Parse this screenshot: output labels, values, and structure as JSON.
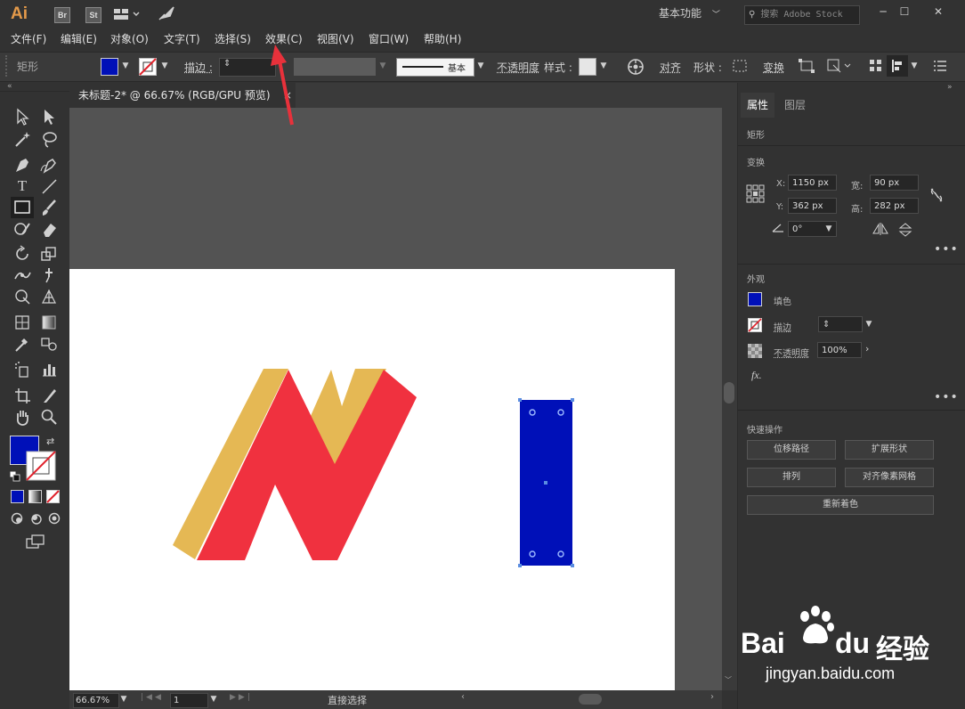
{
  "app": {
    "logo": "Ai",
    "bridge_label": "Br",
    "stock_label": "St"
  },
  "titlebar": {
    "workspace": "基本功能",
    "search_placeholder": "搜索 Adobe Stock",
    "min": "─",
    "max": "☐",
    "close": "✕"
  },
  "menu": [
    "文件(F)",
    "编辑(E)",
    "对象(O)",
    "文字(T)",
    "选择(S)",
    "效果(C)",
    "视图(V)",
    "窗口(W)",
    "帮助(H)"
  ],
  "controlbar": {
    "tool_name": "矩形",
    "fill_color": "#0010b8",
    "stroke_label": "描边 :",
    "stroke_style": "基本",
    "opacity_label": "不透明度",
    "style_label": "样式 :",
    "align_label": "对齐",
    "shape_label": "形状 :",
    "transform_label": "变换"
  },
  "document": {
    "tab_title": "未标题-2* @ 66.67% (RGB/GPU 预览)",
    "close": "×"
  },
  "statusbar": {
    "zoom": "66.67%",
    "artboard": "1",
    "tool_status": "直接选择"
  },
  "panel": {
    "tabs": [
      "属性",
      "图层"
    ],
    "object_type": "矩形",
    "transform": {
      "title": "变换",
      "x_label": "X:",
      "x_value": "1150 px",
      "y_label": "Y:",
      "y_value": "362 px",
      "w_label": "宽:",
      "w_value": "90 px",
      "h_label": "高:",
      "h_value": "282 px",
      "angle_value": "0°"
    },
    "appearance": {
      "title": "外观",
      "fill_label": "填色",
      "fill_color": "#0010b8",
      "stroke_label": "描边",
      "opacity_label": "不透明度",
      "opacity_value": "100%",
      "fx_label": "fx."
    },
    "quick_actions": {
      "title": "快速操作",
      "buttons": [
        "位移路径",
        "扩展形状",
        "排列",
        "对齐像素网格",
        "重新着色"
      ]
    }
  },
  "artwork": {
    "shadow_color": "#e5b854",
    "front_color": "#f0313f",
    "rect_color": "#0010b8"
  },
  "watermark": {
    "brand": "Bai",
    "brand_tail": "du",
    "cn_text": "经验",
    "url": "jingyan.baidu.com"
  }
}
